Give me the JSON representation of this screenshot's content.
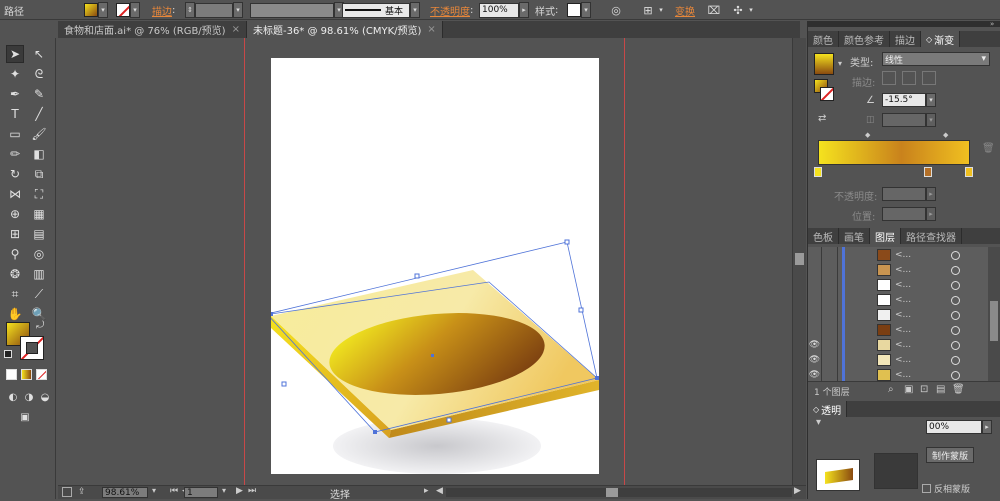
{
  "control": {
    "object_type": "路径",
    "stroke_label": "描边",
    "stroke_style": "基本",
    "opacity_label": "不透明度",
    "opacity_value": "100%",
    "style_label": "样式",
    "transform_label": "变换"
  },
  "tabs": [
    {
      "label": "食物和店面.ai* @ 76% (RGB/预览)",
      "close": "×"
    },
    {
      "label": "未标题-36* @ 98.61% (CMYK/预览)",
      "close": "×"
    }
  ],
  "status": {
    "zoom": "98.61%",
    "page": "1",
    "tool": "选择"
  },
  "panel_top": {
    "tabs": [
      "颜色",
      "颜色参考",
      "描边",
      "渐变"
    ],
    "type_label": "类型",
    "type_value": "线性",
    "stroke_label": "描边",
    "angle_value": "-15.5°",
    "opacity_label": "不透明度",
    "position_label": "位置"
  },
  "panel_layers": {
    "tabs": [
      "色板",
      "画笔",
      "图层",
      "路径查找器"
    ],
    "layer_count": "1 个图层",
    "row_name": "<...",
    "rows": [
      {
        "thumb": "#8a4a1a",
        "visible": false
      },
      {
        "thumb": "#c89450",
        "visible": false
      },
      {
        "thumb": "#ffffff",
        "visible": false
      },
      {
        "thumb": "#ffffff",
        "visible": false
      },
      {
        "thumb": "#f0f0f0",
        "visible": false
      },
      {
        "thumb": "#7a3e12",
        "visible": false
      },
      {
        "thumb": "#e8d8a0",
        "visible": true
      },
      {
        "thumb": "#f2e6b8",
        "visible": true
      },
      {
        "thumb": "#e0c050",
        "visible": true
      }
    ]
  },
  "panel_bottom": {
    "tab": "透明",
    "opacity_value": "00%",
    "make_mask": "制作蒙版",
    "invert_mask": "反相蒙版"
  },
  "colors": {
    "gradient_start": "#f5e21e",
    "gradient_mid": "#c9821c",
    "gradient_end": "#f0c020",
    "guide_red": "#c84848",
    "selection_blue": "#4f73d8"
  }
}
